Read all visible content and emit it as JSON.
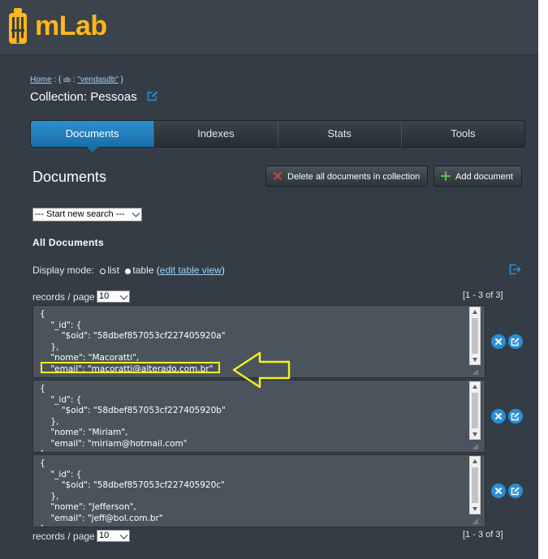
{
  "header": {
    "logo_text": "mLab",
    "logo_icon": "mlab-bottle-icon"
  },
  "breadcrumb": {
    "home": "Home",
    "sep1": " : { ",
    "db_label": "db",
    "sep2": " : ",
    "db_name": "\"vendasdb\"",
    "end": " }"
  },
  "collection": {
    "title": "Collection: Pessoas",
    "edit_icon": "edit-icon"
  },
  "tabs": [
    {
      "label": "Documents",
      "active": true
    },
    {
      "label": "Indexes",
      "active": false
    },
    {
      "label": "Stats",
      "active": false
    },
    {
      "label": "Tools",
      "active": false
    }
  ],
  "documents": {
    "heading": "Documents",
    "delete_all_label": "Delete all documents in collection",
    "add_label": "Add document",
    "search_select": "--- Start new search ---",
    "all_heading": "All Documents",
    "display_mode_label": "Display mode:",
    "mode_list": "list",
    "mode_table": "table",
    "paren_open": " (",
    "edit_table_view": "edit table view",
    "paren_close": ")"
  },
  "pagination": {
    "label": "records / page",
    "per_page": "10",
    "range": "[1 - 3 of 3]"
  },
  "records": [
    {
      "text": "{\n    \"_id\": {\n        \"$oid\": \"58dbef857053cf227405920a\"\n    },\n    \"nome\": \"Macoratti\",\n    \"email\": \"macoratti@alterado.com.br\""
    },
    {
      "text": "{\n    \"_id\": {\n        \"$oid\": \"58dbef857053cf227405920b\"\n    },\n    \"nome\": \"Miriam\",\n    \"email\": \"miriam@hotmail.com\"\n}"
    },
    {
      "text": "{\n    \"_id\": {\n        \"$oid\": \"58dbef857053cf227405920c\"\n    },\n    \"nome\": \"Jefferson\",\n    \"email\": \"jeff@bol.com.br\"\n}"
    }
  ],
  "colors": {
    "accent": "#2a8fd6",
    "logo": "#ffb71b",
    "background": "#343d46",
    "annotation": "#f2f21c"
  }
}
